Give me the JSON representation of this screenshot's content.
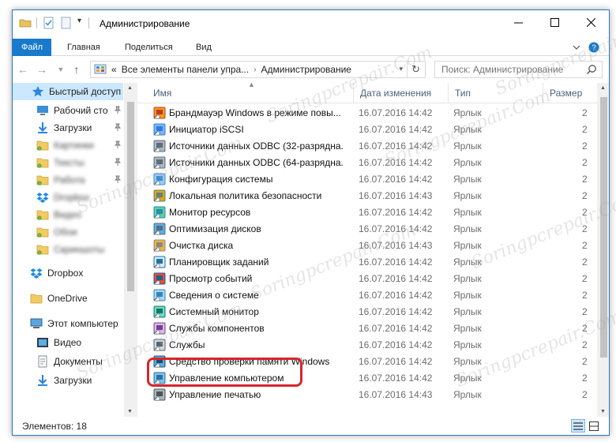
{
  "window": {
    "title": "Администрирование",
    "min_glyph": "—",
    "max_glyph": "☐",
    "close_glyph": "✕"
  },
  "ribbon": {
    "tabs": [
      "Файл",
      "Главная",
      "Поделиться",
      "Вид"
    ],
    "active_tab": "Файл",
    "accent_color": "#1979ca"
  },
  "address": {
    "prefix": "«",
    "segments": [
      "Все элементы панели упра...",
      "Администрирование"
    ],
    "search_placeholder": "Поиск: Администрирование"
  },
  "sidebar": {
    "items": [
      {
        "label": "Быстрый доступ",
        "icon": "star-icon",
        "selected": true,
        "pinned": false,
        "blurred": false
      },
      {
        "label": "Рабочий сто",
        "icon": "desktop-icon",
        "selected": false,
        "pinned": true,
        "blurred": false
      },
      {
        "label": "Загрузки",
        "icon": "download-icon",
        "selected": false,
        "pinned": true,
        "blurred": false
      },
      {
        "label": "Картинки",
        "icon": "folder-icon",
        "selected": false,
        "pinned": true,
        "blurred": true
      },
      {
        "label": "Тексты",
        "icon": "folder-icon",
        "selected": false,
        "pinned": true,
        "blurred": true
      },
      {
        "label": "Работа",
        "icon": "folder-icon",
        "selected": false,
        "pinned": true,
        "blurred": true
      },
      {
        "label": "Dropbox",
        "icon": "dropbox-icon",
        "selected": false,
        "pinned": false,
        "blurred": true
      },
      {
        "label": "Видео",
        "icon": "folder-icon",
        "selected": false,
        "pinned": false,
        "blurred": true
      },
      {
        "label": "Обои",
        "icon": "folder-icon",
        "selected": false,
        "pinned": false,
        "blurred": true
      },
      {
        "label": "Скриншоты",
        "icon": "folder-icon",
        "selected": false,
        "pinned": false,
        "blurred": true
      },
      {
        "label": "Dropbox",
        "icon": "dropbox-icon",
        "selected": false,
        "pinned": false,
        "blurred": false
      },
      {
        "label": "OneDrive",
        "icon": "onedrive-icon",
        "selected": false,
        "pinned": false,
        "blurred": false
      },
      {
        "label": "Этот компьютер",
        "icon": "computer-icon",
        "selected": false,
        "pinned": false,
        "blurred": false
      },
      {
        "label": "Видео",
        "icon": "video-icon",
        "selected": false,
        "pinned": false,
        "blurred": false
      },
      {
        "label": "Документы",
        "icon": "documents-icon",
        "selected": false,
        "pinned": false,
        "blurred": false
      },
      {
        "label": "Загрузки",
        "icon": "download-icon",
        "selected": false,
        "pinned": false,
        "blurred": false
      }
    ]
  },
  "columns": {
    "name": "Имя",
    "date": "Дата изменения",
    "type": "Тип",
    "size": "Размер"
  },
  "files": [
    {
      "name": "Брандмауэр Windows в режиме повы...",
      "date": "16.07.2016 14:42",
      "type": "Ярлык",
      "size": "2",
      "icon": "firewall-icon"
    },
    {
      "name": "Инициатор iSCSI",
      "date": "16.07.2016 14:42",
      "type": "Ярлык",
      "size": "2",
      "icon": "iscsi-icon"
    },
    {
      "name": "Источники данных ODBC (32-разрядна...",
      "date": "16.07.2016 14:42",
      "type": "Ярлык",
      "size": "2",
      "icon": "odbc-icon"
    },
    {
      "name": "Источники данных ODBC (64-разрядна...",
      "date": "16.07.2016 14:42",
      "type": "Ярлык",
      "size": "2",
      "icon": "odbc-icon"
    },
    {
      "name": "Конфигурация системы",
      "date": "16.07.2016 14:42",
      "type": "Ярлык",
      "size": "2",
      "icon": "msconfig-icon"
    },
    {
      "name": "Локальная политика безопасности",
      "date": "16.07.2016 14:43",
      "type": "Ярлык",
      "size": "2",
      "icon": "security-policy-icon"
    },
    {
      "name": "Монитор ресурсов",
      "date": "16.07.2016 14:42",
      "type": "Ярлык",
      "size": "2",
      "icon": "resource-monitor-icon"
    },
    {
      "name": "Оптимизация дисков",
      "date": "16.07.2016 14:42",
      "type": "Ярлык",
      "size": "2",
      "icon": "defrag-icon"
    },
    {
      "name": "Очистка диска",
      "date": "16.07.2016 14:43",
      "type": "Ярлык",
      "size": "2",
      "icon": "disk-cleanup-icon"
    },
    {
      "name": "Планировщик заданий",
      "date": "16.07.2016 14:42",
      "type": "Ярлык",
      "size": "2",
      "icon": "task-scheduler-icon"
    },
    {
      "name": "Просмотр событий",
      "date": "16.07.2016 14:42",
      "type": "Ярлык",
      "size": "2",
      "icon": "event-viewer-icon"
    },
    {
      "name": "Сведения о системе",
      "date": "16.07.2016 14:42",
      "type": "Ярлык",
      "size": "2",
      "icon": "system-info-icon"
    },
    {
      "name": "Системный монитор",
      "date": "16.07.2016 14:42",
      "type": "Ярлык",
      "size": "2",
      "icon": "perfmon-icon"
    },
    {
      "name": "Службы компонентов",
      "date": "16.07.2016 14:42",
      "type": "Ярлык",
      "size": "2",
      "icon": "component-services-icon"
    },
    {
      "name": "Службы",
      "date": "16.07.2016 14:42",
      "type": "Ярлык",
      "size": "2",
      "icon": "services-icon"
    },
    {
      "name": "Средство проверки памяти Windows",
      "date": "16.07.2016 14:42",
      "type": "Ярлык",
      "size": "2",
      "icon": "memory-diagnostic-icon"
    },
    {
      "name": "Управление компьютером",
      "date": "16.07.2016 14:42",
      "type": "Ярлык",
      "size": "2",
      "icon": "computer-management-icon"
    },
    {
      "name": "Управление печатью",
      "date": "16.07.2016 14:43",
      "type": "Ярлык",
      "size": "2",
      "icon": "print-management-icon"
    }
  ],
  "status": {
    "text": "Элементов: 18"
  },
  "watermark": "Soringpcrepair.Com"
}
